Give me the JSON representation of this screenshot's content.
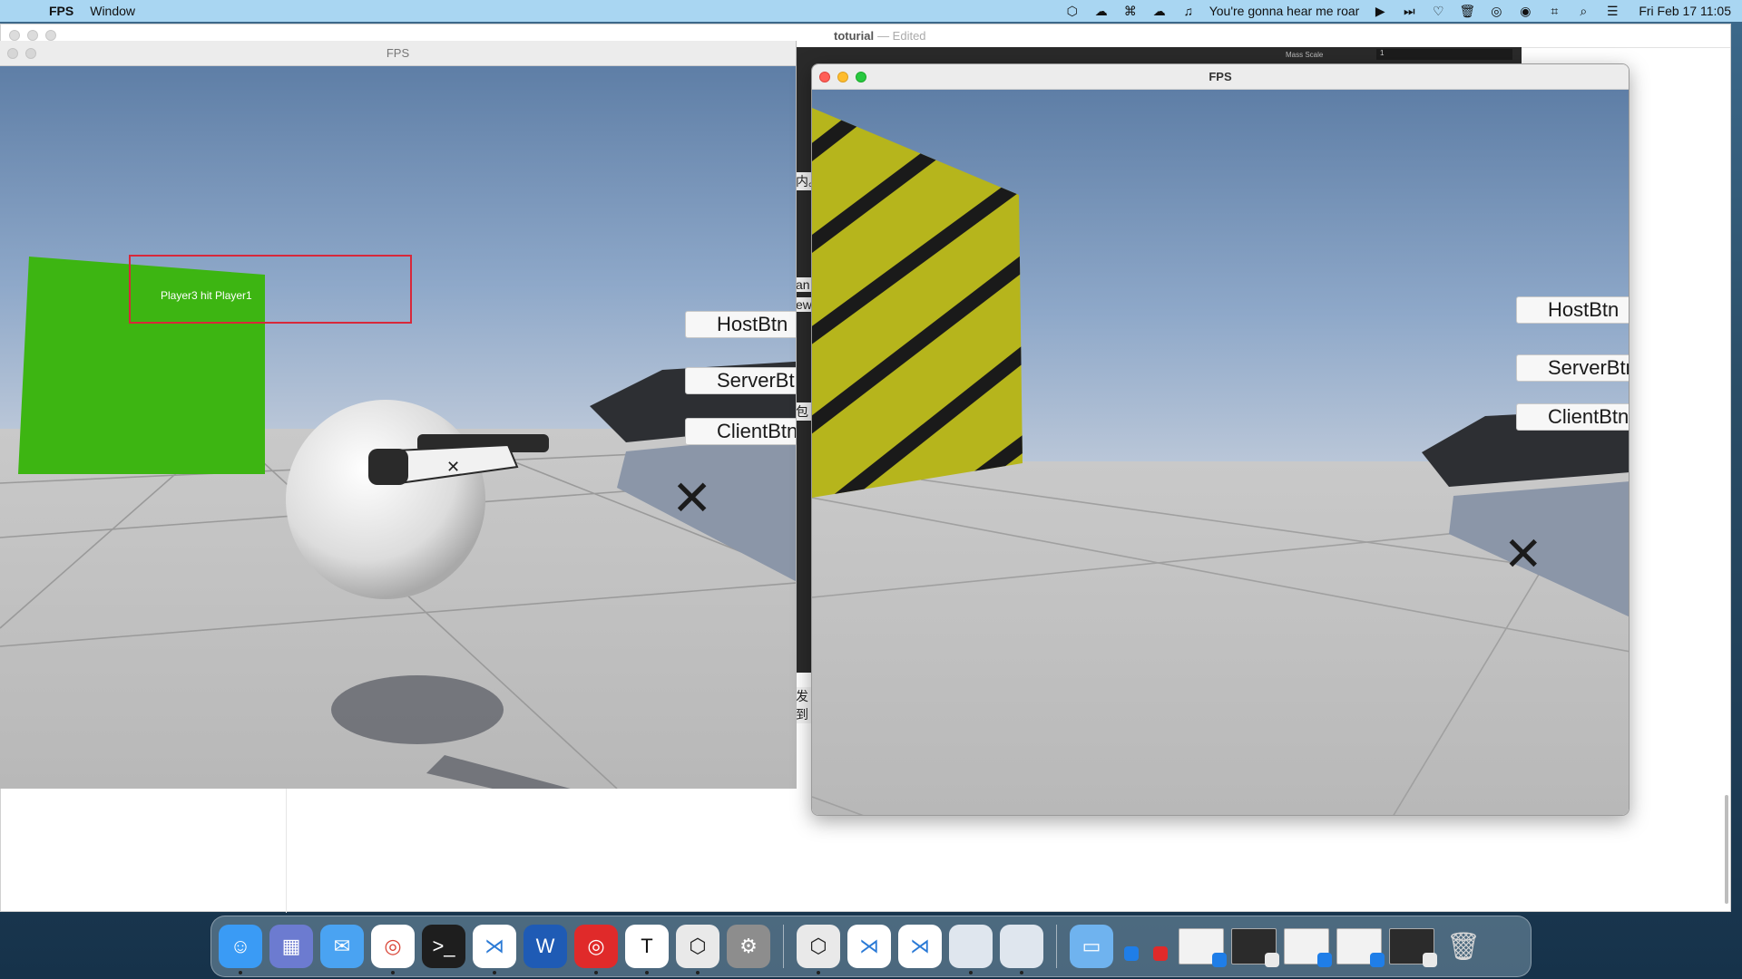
{
  "menubar": {
    "app_name": "FPS",
    "menu_window": "Window",
    "now_playing": "You're gonna hear me roar",
    "clock": "Fri Feb 17  11:05"
  },
  "document": {
    "title": "toturial",
    "status": "— Edited",
    "inspector_label": "Mass Scale",
    "inspector_value": "1",
    "gap_texts": [
      "内。",
      "an",
      "ew",
      "包",
      "发到"
    ]
  },
  "game_left": {
    "title": "FPS",
    "hit_message": "Player3 hit Player1",
    "buttons": [
      "HostBtn",
      "ServerBtn",
      "ClientBtn"
    ]
  },
  "game_right": {
    "title": "FPS",
    "buttons": [
      "HostBtn",
      "ServerBtn",
      "ClientBtn"
    ]
  },
  "dock": {
    "apps": [
      {
        "name": "Finder",
        "icon": "finder-icon",
        "color": "#3a9bf5"
      },
      {
        "name": "Launchpad",
        "icon": "launchpad-icon",
        "color": "#6c7bd0"
      },
      {
        "name": "Mail",
        "icon": "mail-icon",
        "color": "#4aa3f2"
      },
      {
        "name": "Chrome",
        "icon": "chrome-icon",
        "color": "#ffffff"
      },
      {
        "name": "Terminal",
        "icon": "terminal-icon",
        "color": "#1e1e1e"
      },
      {
        "name": "VS Code",
        "icon": "vscode-icon",
        "color": "#ffffff"
      },
      {
        "name": "Word",
        "icon": "word-icon",
        "color": "#1f5bb5"
      },
      {
        "name": "NetEase Music",
        "icon": "music-icon",
        "color": "#e02a2a"
      },
      {
        "name": "Typora",
        "icon": "typora-icon",
        "color": "#ffffff"
      },
      {
        "name": "Unity Hub",
        "icon": "unity-hub-icon",
        "color": "#e9e9e9"
      },
      {
        "name": "System Settings",
        "icon": "settings-icon",
        "color": "#8d8d8d"
      }
    ],
    "recent": [
      {
        "name": "Unity",
        "icon": "unity-icon",
        "color": "#e9e9e9"
      },
      {
        "name": "VS Code",
        "icon": "vscode-icon",
        "color": "#ffffff"
      },
      {
        "name": "VS Code",
        "icon": "vscode-icon",
        "color": "#ffffff"
      },
      {
        "name": "Blank App",
        "icon": "blank-app-icon",
        "color": "#dfe6ee"
      },
      {
        "name": "Blank App",
        "icon": "blank-app-icon",
        "color": "#dfe6ee"
      }
    ]
  }
}
